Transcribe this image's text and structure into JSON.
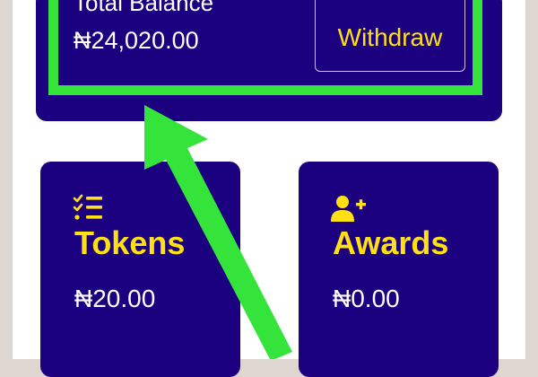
{
  "balance": {
    "label": "Total Balance",
    "amount": "₦24,020.00",
    "withdraw_label": "Withdraw"
  },
  "cards": {
    "tokens": {
      "title": "Tokens",
      "value": "₦20.00",
      "icon": "checklist-icon"
    },
    "awards": {
      "title": "Awards",
      "value": "₦0.00",
      "icon": "add-user-icon"
    }
  },
  "colors": {
    "card_background": "#1b0080",
    "accent_yellow": "#ffe014",
    "highlight_green": "#35e43a",
    "outer_background": "#ddd6d1"
  }
}
